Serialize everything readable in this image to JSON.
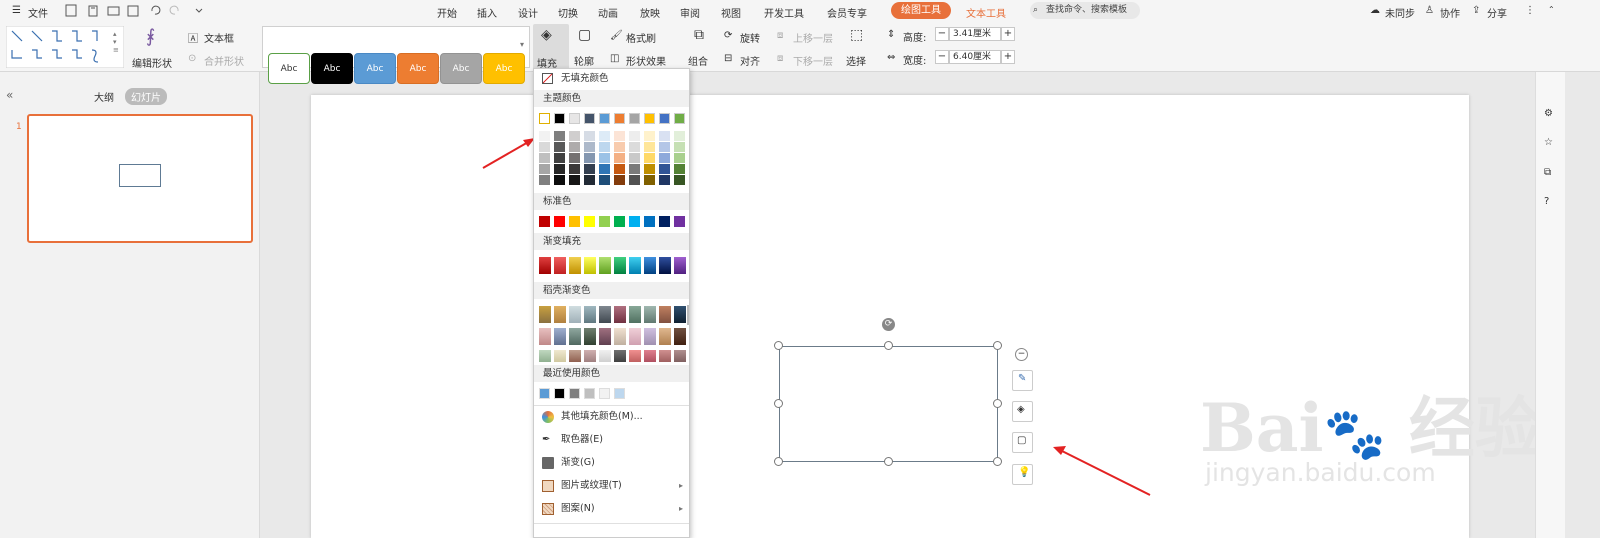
{
  "menubar": {
    "file": "文件",
    "tabs": [
      "开始",
      "插入",
      "设计",
      "切换",
      "动画",
      "放映",
      "审阅",
      "视图",
      "开发工具",
      "会员专享"
    ],
    "drawing_tools": "绘图工具",
    "text_tools": "文本工具",
    "search_placeholder": "查找命令、搜索模板",
    "not_synced": "未同步",
    "collaborate": "协作",
    "share": "分享"
  },
  "ribbon": {
    "edit_shape": "编辑形状",
    "textbox": "文本框",
    "merge_shape": "合并形状",
    "style_label": "Abc",
    "styles": [
      {
        "fill": "#ffffff",
        "border": "#5aa046",
        "text": "#333333"
      },
      {
        "fill": "#000000",
        "border": "#000000",
        "text": "#ffffff"
      },
      {
        "fill": "#5b9bd5",
        "border": "#4a89c4",
        "text": "#ffffff"
      },
      {
        "fill": "#ed7d31",
        "border": "#d86e24",
        "text": "#ffffff"
      },
      {
        "fill": "#a5a5a5",
        "border": "#939393",
        "text": "#ffffff"
      },
      {
        "fill": "#ffc000",
        "border": "#e2aa00",
        "text": "#ffffff"
      }
    ],
    "fill": "填充",
    "outline": "轮廓",
    "format_painter": "格式刷",
    "shape_effects": "形状效果",
    "group": "组合",
    "rotate": "旋转",
    "align": "对齐",
    "bring_forward": "上移一层",
    "send_backward": "下移一层",
    "select": "选择",
    "height_label": "高度:",
    "height_value": "3.41厘米",
    "width_label": "宽度:",
    "width_value": "6.40厘米"
  },
  "leftpanel": {
    "outline_tab": "大纲",
    "slides_tab": "幻灯片",
    "slide_number": "1"
  },
  "dropdown": {
    "no_fill": "无填充颜色",
    "theme_colors": "主题颜色",
    "standard_colors": "标准色",
    "gradient_fill": "渐变填充",
    "shell_gradient": "稻壳渐变色",
    "recent_colors": "最近使用颜色",
    "more_colors": "其他填充颜色(M)...",
    "eyedropper": "取色器(E)",
    "gradient": "渐变(G)",
    "picture_texture": "图片或纹理(T)",
    "pattern": "图案(N)"
  },
  "watermark": {
    "logo": "Bai du 经验",
    "url": "jingyan.baidu.com"
  },
  "colors": {
    "accent_orange": "#e8703a",
    "arrow_red": "#e32222",
    "theme_row": [
      "#ffffff",
      "#000000",
      "#e7e6e6",
      "#44546a",
      "#5b9bd5",
      "#ed7d31",
      "#a5a5a5",
      "#ffc000",
      "#4472c4",
      "#70ad47"
    ],
    "theme_shades": [
      [
        "#f2f2f2",
        "#d9d9d9",
        "#bfbfbf",
        "#a6a6a6",
        "#808080"
      ],
      [
        "#7f7f7f",
        "#595959",
        "#404040",
        "#262626",
        "#0d0d0d"
      ],
      [
        "#d0cece",
        "#aeabab",
        "#757171",
        "#3b3838",
        "#171616"
      ],
      [
        "#d6dce5",
        "#adb9ca",
        "#8497b0",
        "#333f50",
        "#222a35"
      ],
      [
        "#ddebf7",
        "#bdd7ee",
        "#9bc2e6",
        "#2f75b5",
        "#1f4e79"
      ],
      [
        "#fce4d6",
        "#f8cbad",
        "#f4b084",
        "#c65911",
        "#833c0c"
      ],
      [
        "#ededed",
        "#dbdbdb",
        "#c9c9c9",
        "#7b7b7b",
        "#525252"
      ],
      [
        "#fff2cc",
        "#ffe699",
        "#ffd966",
        "#bf8f00",
        "#806000"
      ],
      [
        "#d9e1f2",
        "#b4c6e7",
        "#8ea9db",
        "#305496",
        "#203764"
      ],
      [
        "#e2efda",
        "#c6e0b4",
        "#a9d08e",
        "#548235",
        "#375623"
      ]
    ],
    "standard": [
      "#c00000",
      "#ff0000",
      "#ffc000",
      "#ffff00",
      "#92d050",
      "#00b050",
      "#00b0f0",
      "#0070c0",
      "#002060",
      "#7030a0"
    ],
    "gradients": [
      [
        "#e04040",
        "#a00000"
      ],
      [
        "#f06060",
        "#c02020"
      ],
      [
        "#f0d050",
        "#c09000"
      ],
      [
        "#ffff60",
        "#c0c000"
      ],
      [
        "#b0e070",
        "#60a020"
      ],
      [
        "#40d080",
        "#008040"
      ],
      [
        "#40d0f0",
        "#0080b0"
      ],
      [
        "#4090e0",
        "#004080"
      ],
      [
        "#3050a0",
        "#001040"
      ],
      [
        "#a060d0",
        "#502080"
      ]
    ],
    "shell": [
      [
        "#c8a040",
        "#8a7040"
      ],
      [
        "#e0b060",
        "#b08040"
      ],
      [
        "#d0dde0",
        "#a0b0b8"
      ],
      [
        "#a0b8c0",
        "#607880"
      ],
      [
        "#808890",
        "#404850"
      ],
      [
        "#b07080",
        "#703040"
      ],
      [
        "#88a898",
        "#507060"
      ],
      [
        "#a0b8b0",
        "#607870"
      ],
      [
        "#c08060",
        "#805040"
      ],
      [
        "#305070",
        "#102030"
      ],
      [
        "#e8c0c0",
        "#c08888"
      ],
      [
        "#a0b0d0",
        "#607090"
      ],
      [
        "#90a8a0",
        "#506860"
      ],
      [
        "#708070",
        "#304030"
      ],
      [
        "#a07080",
        "#604050"
      ],
      [
        "#f0e0d0",
        "#c0b0a0"
      ],
      [
        "#f0d0d8",
        "#d0a0b0"
      ],
      [
        "#d0c0e0",
        "#a090b0"
      ],
      [
        "#e0b890",
        "#b08050"
      ],
      [
        "#705040",
        "#402010"
      ],
      [
        "#c0d8c0",
        "#90b090"
      ],
      [
        "#f0e8d0",
        "#d0c8a0"
      ],
      [
        "#c0a090",
        "#906050"
      ],
      [
        "#d0b0b0",
        "#a08080"
      ],
      [
        "#f0f0f0",
        "#d0d0d0"
      ],
      [
        "#707070",
        "#404040"
      ],
      [
        "#f09090",
        "#c06060"
      ],
      [
        "#e08090",
        "#b05060"
      ],
      [
        "#d09090",
        "#a06060"
      ],
      [
        "#b09090",
        "#806060"
      ]
    ],
    "recent": [
      "#5b9bd5",
      "#000000",
      "#7f7f7f",
      "#bfbfbf",
      "#f2f2f2",
      "#bdd7ee"
    ]
  }
}
